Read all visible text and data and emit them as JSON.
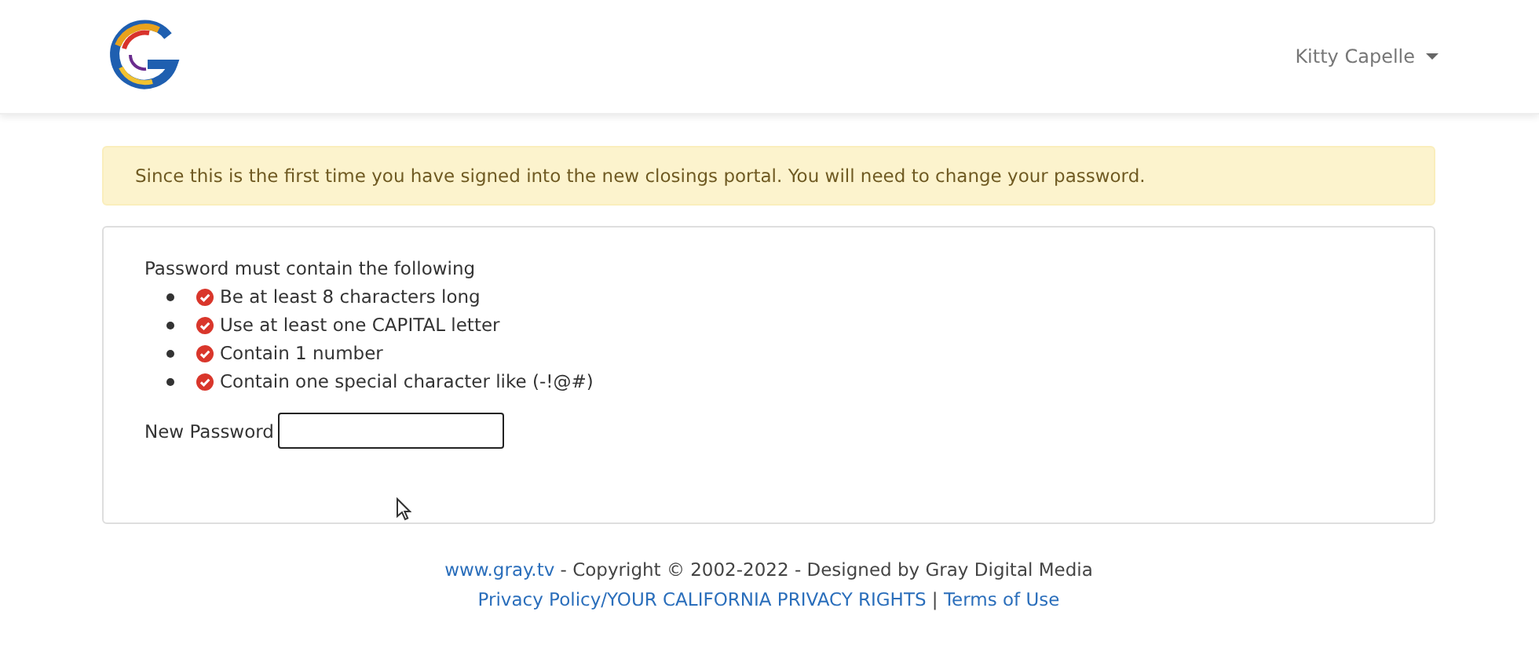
{
  "header": {
    "user_menu": {
      "label": "Kitty Capelle"
    }
  },
  "alert": {
    "message": "Since this is the first time you have signed into the new closings portal. You will need to change your password."
  },
  "requirements": {
    "title": "Password must contain the following",
    "items": [
      {
        "text": "Be at least 8 characters long"
      },
      {
        "text": "Use at least one CAPITAL letter"
      },
      {
        "text": "Contain 1 number"
      },
      {
        "text": "Contain one special character like (-!@#)"
      }
    ]
  },
  "new_password": {
    "label": "New Password"
  },
  "footer": {
    "lines": [
      [
        {
          "kind": "link",
          "text": "www.gray.tv"
        },
        {
          "kind": "text",
          "text": " - Copyright © 2002-2022 - Designed by Gray Digital Media"
        }
      ],
      [
        {
          "kind": "link",
          "text": "Privacy Policy/YOUR CALIFORNIA PRIVACY RIGHTS"
        },
        {
          "kind": "text",
          "text": " | "
        },
        {
          "kind": "link",
          "text": "Terms of Use"
        }
      ]
    ]
  }
}
